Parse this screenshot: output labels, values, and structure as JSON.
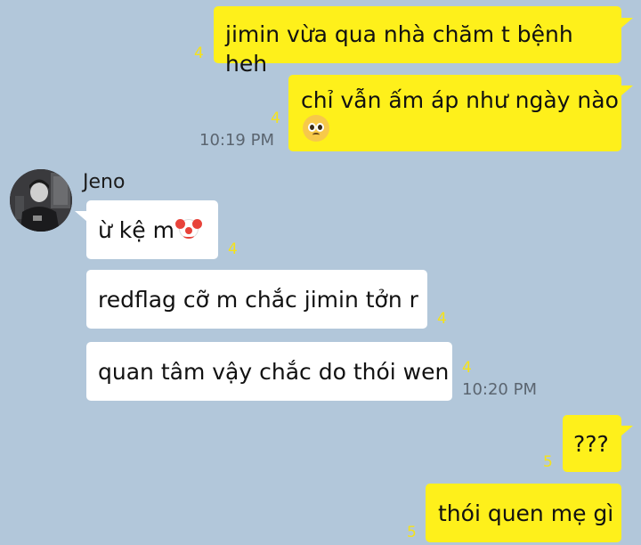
{
  "colors": {
    "background": "#b2c7da",
    "my_bubble": "#fef01b",
    "their_bubble": "#ffffff",
    "unread_count": "#f5e21a",
    "timestamp": "#5b6570"
  },
  "contact": {
    "name": "Jeno",
    "avatar": "profile-photo"
  },
  "messages": [
    {
      "from": "me",
      "text": "jimin vừa qua nhà chăm t bệnh heh",
      "unread": "4"
    },
    {
      "from": "me",
      "text": "chỉ vẫn ấm áp như ngày nào",
      "emoji": "pleading-face-emoji",
      "unread": "4",
      "time": "10:19 PM"
    },
    {
      "from": "them",
      "text": "ừ kệ m",
      "emoji": "clown-face-emoji",
      "unread": "4"
    },
    {
      "from": "them",
      "text": "redflag cỡ m chắc jimin tởn r",
      "unread": "4"
    },
    {
      "from": "them",
      "text": "quan tâm vậy chắc do thói wen",
      "unread": "4",
      "time": "10:20 PM"
    },
    {
      "from": "me",
      "text": "???",
      "unread": "5"
    },
    {
      "from": "me",
      "text": "thói quen mẹ gì",
      "unread": "5"
    }
  ]
}
